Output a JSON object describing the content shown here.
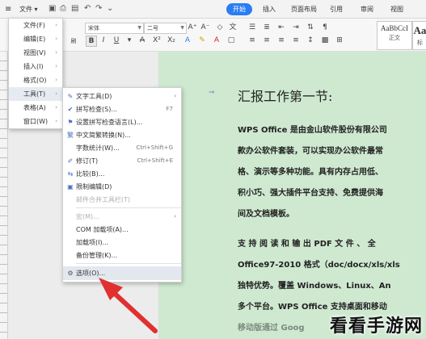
{
  "topbar": {
    "file_menu": "文件",
    "tabs": [
      "开始",
      "插入",
      "页面布局",
      "引用",
      "审阅",
      "视图"
    ]
  },
  "ribbon": {
    "font_name": "宋体",
    "font_size": "二号",
    "bold": "B",
    "italic": "I",
    "underline": "U",
    "style1_sample": "AaBbCcI",
    "style1_label": "正文",
    "style2_sample": "Aa",
    "style2_label": "标"
  },
  "main_menu": {
    "items": [
      {
        "label": "文件(F)"
      },
      {
        "label": "编辑(E)"
      },
      {
        "label": "视图(V)"
      },
      {
        "label": "插入(I)"
      },
      {
        "label": "格式(O)"
      },
      {
        "label": "工具(T)"
      },
      {
        "label": "表格(A)"
      },
      {
        "label": "窗口(W)"
      }
    ]
  },
  "tools_submenu": {
    "items": [
      {
        "label": "文字工具(D)",
        "shortcut": ""
      },
      {
        "label": "拼写检查(S)...",
        "shortcut": "F7"
      },
      {
        "label": "设置拼写检查语言(L)...",
        "shortcut": ""
      },
      {
        "label": "中文简繁转换(N)...",
        "shortcut": ""
      },
      {
        "label": "字数统计(W)...",
        "shortcut": "Ctrl+Shift+G"
      },
      {
        "label": "修订(T)",
        "shortcut": "Ctrl+Shift+E"
      },
      {
        "label": "比较(B)...",
        "shortcut": ""
      },
      {
        "label": "限制编辑(D)",
        "shortcut": ""
      },
      {
        "label": "邮件合并工具栏(T)",
        "shortcut": ""
      },
      {
        "label": "宏(M)...",
        "shortcut": ""
      },
      {
        "label": "COM 加载项(A)...",
        "shortcut": ""
      },
      {
        "label": "加载项(I)...",
        "shortcut": ""
      },
      {
        "label": "备份管理(K)...",
        "shortcut": ""
      },
      {
        "label": "选项(O)...",
        "shortcut": ""
      }
    ]
  },
  "document": {
    "title": "汇报工作第一节:",
    "lines": [
      "WPS Office 是由金山软件股份有限公司",
      "款办公软件套装，可以实现办公软件最常",
      "格、演示等多种功能。具有内存占用低、",
      "积小巧、强大插件平台支持、免费提供海",
      "间及文档模板。",
      "支 持 阅 读 和 输 出 PDF 文 件 、 全",
      "Office97-2010 格式（doc/docx/xls/xls",
      "独特优势。覆盖 Windows、Linux、An",
      "多个平台。WPS Office 支持桌面和移动",
      "移动版通过 Goog"
    ]
  },
  "watermark": "看看手游网",
  "colors": {
    "accent": "#2b7cf3",
    "page_bg": "#cfe9d1",
    "arrow": "#e03030"
  }
}
